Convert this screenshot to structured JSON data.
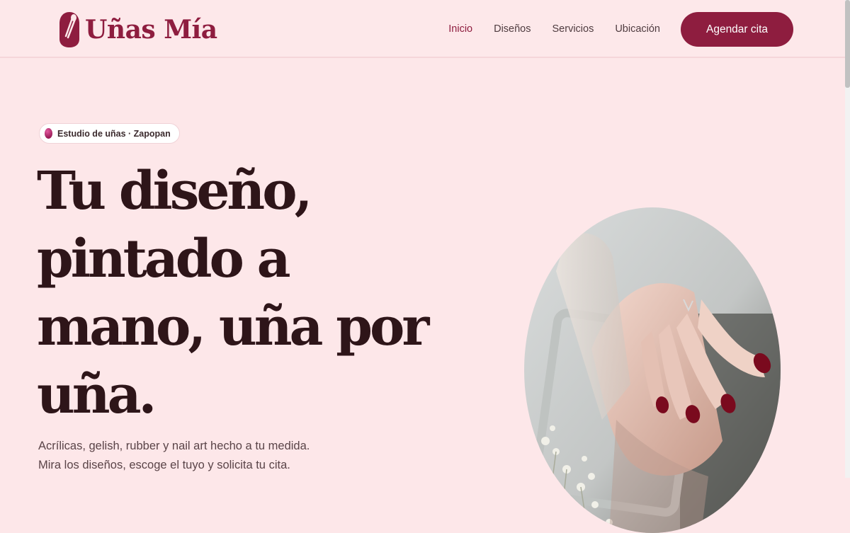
{
  "brand": {
    "name": "Uñas Mía",
    "accent_color": "#8e1d3f",
    "logo_icon": "nail-polish-drop-icon"
  },
  "nav": {
    "items": [
      {
        "label": "Inicio",
        "active": true
      },
      {
        "label": "Diseños",
        "active": false
      },
      {
        "label": "Servicios",
        "active": false
      },
      {
        "label": "Ubicación",
        "active": false
      }
    ],
    "cta_label": "Agendar cita"
  },
  "hero": {
    "badge": {
      "icon": "nail-polish-dot-icon",
      "text": "Estudio de uñas · Zapopan"
    },
    "headline": "Tu diseño, pintado a mano, uña por uña.",
    "subtext_lines": [
      "Acrílicas, gelish, rubber y nail art hecho a tu medida.",
      "Mira los diseños, escoge el tuyo y solicita tu cita."
    ],
    "image": {
      "subject": "hand-with-red-manicure-photo",
      "nail_color": "#7a0a1e"
    }
  }
}
